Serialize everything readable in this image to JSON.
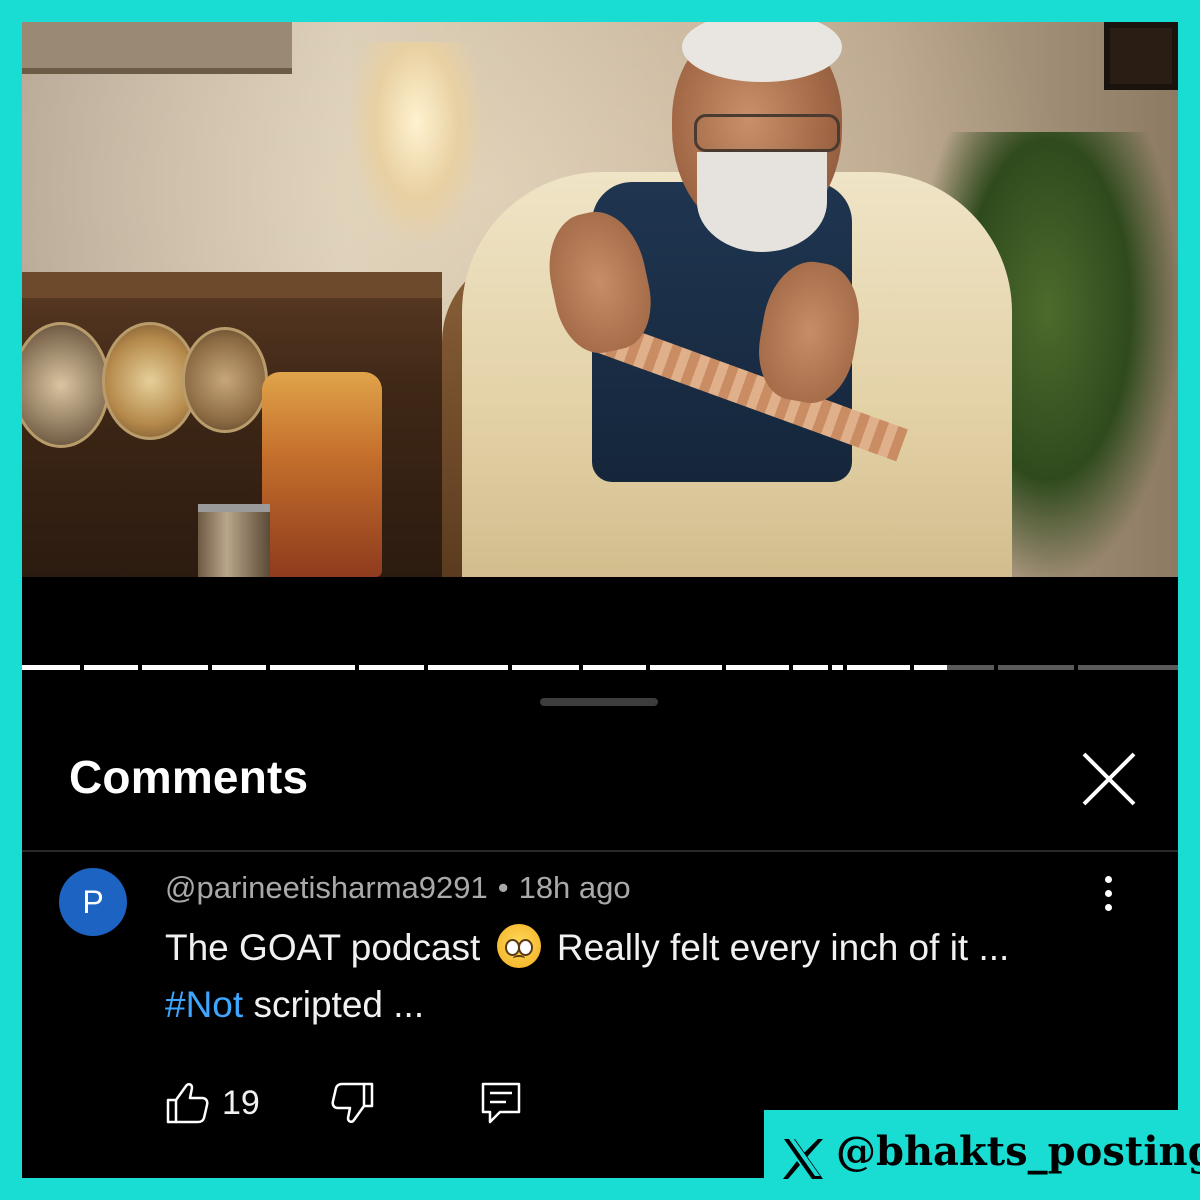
{
  "video": {
    "progress": 0.8,
    "colors": {
      "played": "#ffffff",
      "unplayed": "#5a5a5a"
    }
  },
  "comments_panel": {
    "title": "Comments"
  },
  "comment": {
    "avatar_letter": "P",
    "avatar_color": "#1d63c2",
    "author": "@parineetisharma9291",
    "separator": "•",
    "time": "18h ago",
    "line1_before_emoji": "The GOAT podcast",
    "emoji": "pleading-face-icon",
    "line1_after_emoji": "Really felt every inch of it ...",
    "hashtag": "#Not",
    "line2_rest": "scripted ...",
    "like_count": "19"
  },
  "watermark": {
    "handle": "@bhakts_posting",
    "background": "#19dcd2"
  }
}
